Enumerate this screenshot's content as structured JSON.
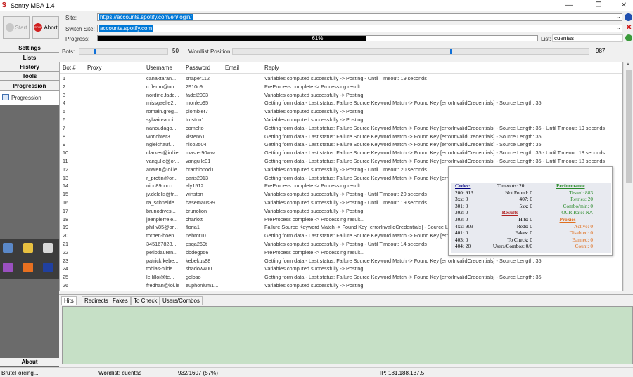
{
  "window": {
    "title": "Sentry MBA 1.4",
    "minimize": "—",
    "restore": "❐",
    "close": "✕"
  },
  "toolbar": {
    "start_label": "Start",
    "abort_label": "Abort",
    "site_label": "Site:",
    "site_value": "https://accounts.spotify.com/en/login/",
    "switch_site_label": "Switch Site:",
    "switch_site_value": "accounts.spotify.com",
    "progress_label": "Progress:",
    "progress_text": "61%",
    "progress_value": 0.61,
    "list_label": "List:",
    "list_value": "cuentas"
  },
  "sidebar": {
    "items": [
      "Settings",
      "Lists",
      "History",
      "Tools",
      "Progression"
    ],
    "progression_child": "Progression",
    "about": "About"
  },
  "controls": {
    "bots_label": "Bots:",
    "bots_value": "50",
    "bots_level": 0.16,
    "wordlist_label": "Wordlist Position:",
    "wordlist_value": "987",
    "wordlist_level": 0.61
  },
  "grid": {
    "headers": [
      "Bot #",
      "Proxy",
      "Username",
      "Password",
      "Email",
      "Reply"
    ],
    "rows": [
      [
        "1",
        "",
        "canaktaran...",
        "snaper112",
        "",
        "Variables computed successfully -> Posting - Until Timeout: 19 seconds"
      ],
      [
        "2",
        "",
        "c.fleuro@on...",
        "2910c9",
        "",
        "PreProcess complete -> Processing result..."
      ],
      [
        "3",
        "",
        "nordine.fade...",
        "fadel2003",
        "",
        "Variables computed successfully -> Posting"
      ],
      [
        "4",
        "",
        "missgaelle2...",
        "monleo95",
        "",
        "Getting form data - Last status: Failure Source Keyword Match -> Found Key [errorInvalidCredentials] - Source Length: 35"
      ],
      [
        "5",
        "",
        "romain.greg...",
        "plombier7",
        "",
        "Variables computed successfully -> Posting"
      ],
      [
        "6",
        "",
        "sylvain-anci...",
        "trustno1",
        "",
        "Variables computed successfully -> Posting"
      ],
      [
        "7",
        "",
        "nanoudago...",
        "comelto",
        "",
        "Getting form data - Last status: Failure Source Keyword Match -> Found Key [errorInvalidCredentials] - Source Length: 35 - Until Timeout: 19 seconds"
      ],
      [
        "8",
        "",
        "worichter3...",
        "kisten61",
        "",
        "Getting form data - Last status: Failure Source Keyword Match -> Found Key [errorInvalidCredentials] - Source Length: 35"
      ],
      [
        "9",
        "",
        "ngleichauf...",
        "nico2504",
        "",
        "Getting form data - Last status: Failure Source Keyword Match -> Found Key [errorInvalidCredentials] - Source Length: 35"
      ],
      [
        "10",
        "",
        "clarkes@iol.ie",
        "master90ww...",
        "",
        "Getting form data - Last status: Failure Source Keyword Match -> Found Key [errorInvalidCredentials] - Source Length: 35 - Until Timeout: 18 seconds"
      ],
      [
        "11",
        "",
        "vangulle@or...",
        "vangulle01",
        "",
        "Getting form data - Last status: Failure Source Keyword Match -> Found Key [errorInvalidCredentials] - Source Length: 35 - Until Timeout: 18 seconds"
      ],
      [
        "12",
        "",
        "anwen@iol.ie",
        "brachiopod1...",
        "",
        "Variables computed successfully -> Posting - Until Timeout: 20 seconds"
      ],
      [
        "13",
        "",
        "r_protin@or...",
        "paris2013",
        "",
        "Getting form data - Last status: Failure Source Keyword Match -> Found Key [err"
      ],
      [
        "14",
        "",
        "nico89coco...",
        "aly1512",
        "",
        "PreProcess complete -> Processing result..."
      ],
      [
        "15",
        "",
        "jv.delelis@fr...",
        "winston",
        "",
        "Variables computed successfully -> Posting - Until Timeout: 20 seconds"
      ],
      [
        "16",
        "",
        "ra_schneide...",
        "hasemaus99",
        "",
        "Variables computed successfully -> Posting - Until Timeout: 19 seconds"
      ],
      [
        "17",
        "",
        "brunodives...",
        "brunolion",
        "",
        "Variables computed successfully -> Posting"
      ],
      [
        "18",
        "",
        "jeanpierrele...",
        "charlott",
        "",
        "PreProcess complete -> Processing result..."
      ],
      [
        "19",
        "",
        "phil.v85@or...",
        "floria1",
        "",
        "Failure Source Keyword Match -> Found Key [errorInvalidCredentials] - Source L"
      ],
      [
        "20",
        "",
        "torben-hoen...",
        "nebrot10",
        "",
        "Getting form data - Last status: Failure Source Keyword Match -> Found Key [err"
      ],
      [
        "21",
        "",
        "345167828...",
        "psqa269t",
        "",
        "Variables computed successfully -> Posting - Until Timeout: 14 seconds"
      ],
      [
        "22",
        "",
        "petiotlauren...",
        "bbdegp56",
        "",
        "PreProcess complete -> Processing result..."
      ],
      [
        "23",
        "",
        "patrick.kebe...",
        "kebekus88",
        "",
        "Getting form data - Last status: Failure Source Keyword Match -> Found Key [errorInvalidCredentials] - Source Length: 35"
      ],
      [
        "24",
        "",
        "tobias-hilde...",
        "shadow400",
        "",
        "Variables computed successfully -> Posting"
      ],
      [
        "25",
        "",
        "le.lilloi@te...",
        "goloso",
        "",
        "Getting form data - Last status: Failure Source Keyword Match -> Found Key [errorInvalidCredentials] - Source Length: 35"
      ],
      [
        "26",
        "",
        "fredhan@iol.ie",
        "euphonium1...",
        "",
        "Variables computed successfully -> Posting"
      ]
    ]
  },
  "stats": {
    "codes_title": "Codes:",
    "timeouts": "Timeouts: 20",
    "performance_title": "Performance",
    "lines": [
      [
        "200: 913",
        "Not Found: 0",
        "Tested: 883"
      ],
      [
        "3xx: 0",
        "407: 0",
        "Retries: 20"
      ],
      [
        "301: 0",
        "5xx: 0",
        "Combo/min: 0"
      ],
      [
        "302: 0",
        "Results",
        "OCR Rate: NA"
      ],
      [
        "303: 0",
        "Hits: 0",
        "Proxies"
      ],
      [
        "4xx: 903",
        "Reds: 0",
        "Active: 0"
      ],
      [
        "401: 0",
        "Fakes: 0",
        "Disabled: 0"
      ],
      [
        "403: 0",
        "To Check: 0",
        "Banned: 0"
      ],
      [
        "404: 20",
        "Users/Combos: 0/0",
        "Count: 0"
      ]
    ]
  },
  "tabs": [
    "Hits",
    "Redirects",
    "Fakes",
    "To Check",
    "Users/Combos"
  ],
  "statusbar": {
    "state": "BruteForcing...",
    "wordlist": "Wordlist: cuentas",
    "position": "932/1607 (57%)",
    "ip": "IP: 181.188.137.5"
  },
  "colors": {
    "hits_panel": "#c6e0c6",
    "sidebar": "#6b6b6b",
    "link_green": "#2a8a2a",
    "proxies_orange": "#e07020"
  }
}
